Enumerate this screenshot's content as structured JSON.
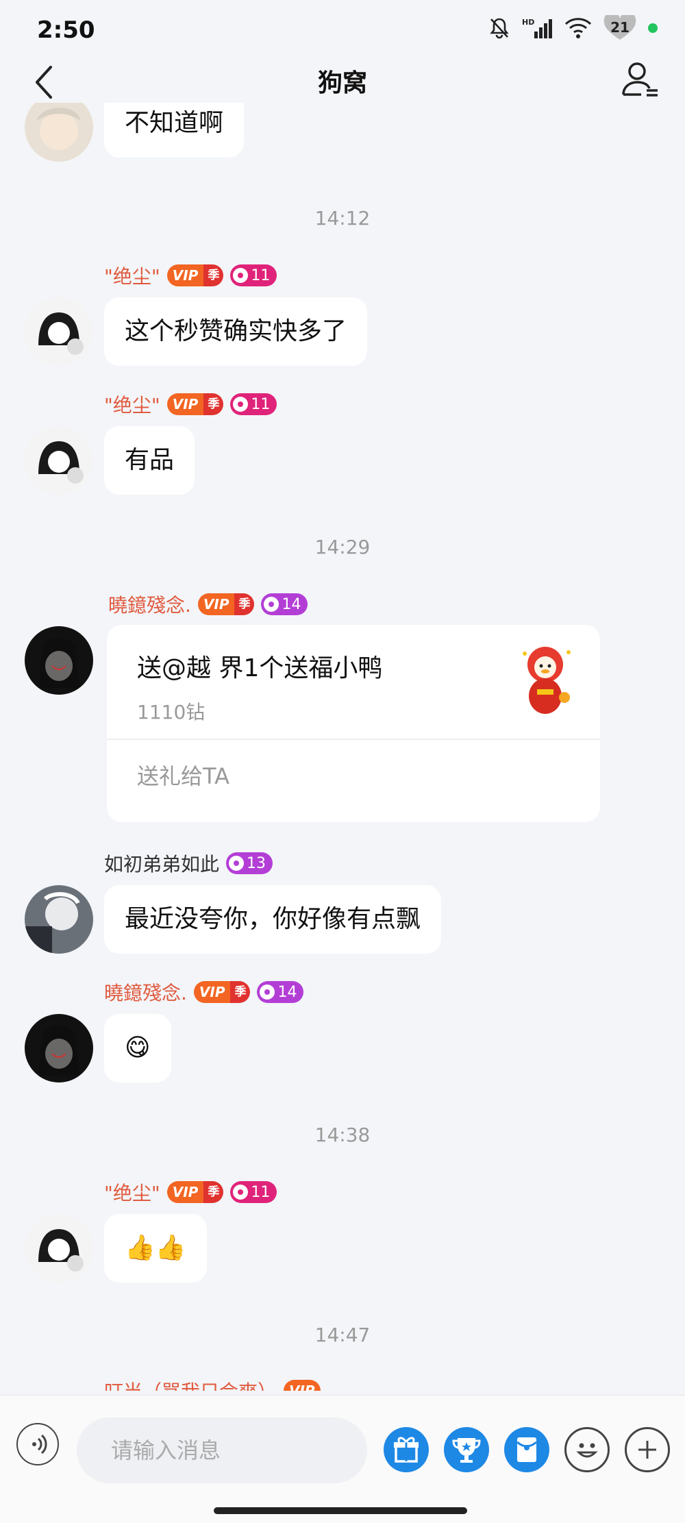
{
  "status_bar": {
    "time": "2:50",
    "battery": "21",
    "icons": [
      "mute-icon",
      "hd-signal-icon",
      "wifi-icon",
      "battery-icon"
    ]
  },
  "header": {
    "title": "狗窝"
  },
  "messages": {
    "m0": {
      "text": "不知道啊"
    },
    "t1": "14:12",
    "m1": {
      "nick": "\"绝尘\"",
      "level": "11",
      "text": "这个秒赞确实快多了"
    },
    "m2": {
      "nick": "\"绝尘\"",
      "level": "11",
      "text": "有品"
    },
    "t2": "14:29",
    "m3": {
      "nick": "曉鐿殘念.",
      "level": "14",
      "gift_title": "送@越 界1个送福小鸭",
      "gift_price": "1110钻",
      "gift_action": "送礼给TA"
    },
    "m4": {
      "nick": "如初弟弟如此",
      "level": "13",
      "text": "最近没夸你，你好像有点飘"
    },
    "m5": {
      "nick": "曉鐿殘念.",
      "level": "14",
      "text": "😋"
    },
    "t3": "14:38",
    "m6": {
      "nick": "\"绝尘\"",
      "level": "11",
      "text": "👍👍"
    },
    "t4": "14:47",
    "m7": {
      "nick": "叮当（骂我只会爽）"
    }
  },
  "vip": {
    "v": "VIP",
    "season": "季"
  },
  "input": {
    "placeholder": "请输入消息"
  },
  "colors": {
    "nick": "#e05a3f",
    "vip": "#f26522",
    "level_pink": "#e0237a",
    "level_purple": "#b33ed6",
    "tool_blue": "#1e88e5"
  }
}
